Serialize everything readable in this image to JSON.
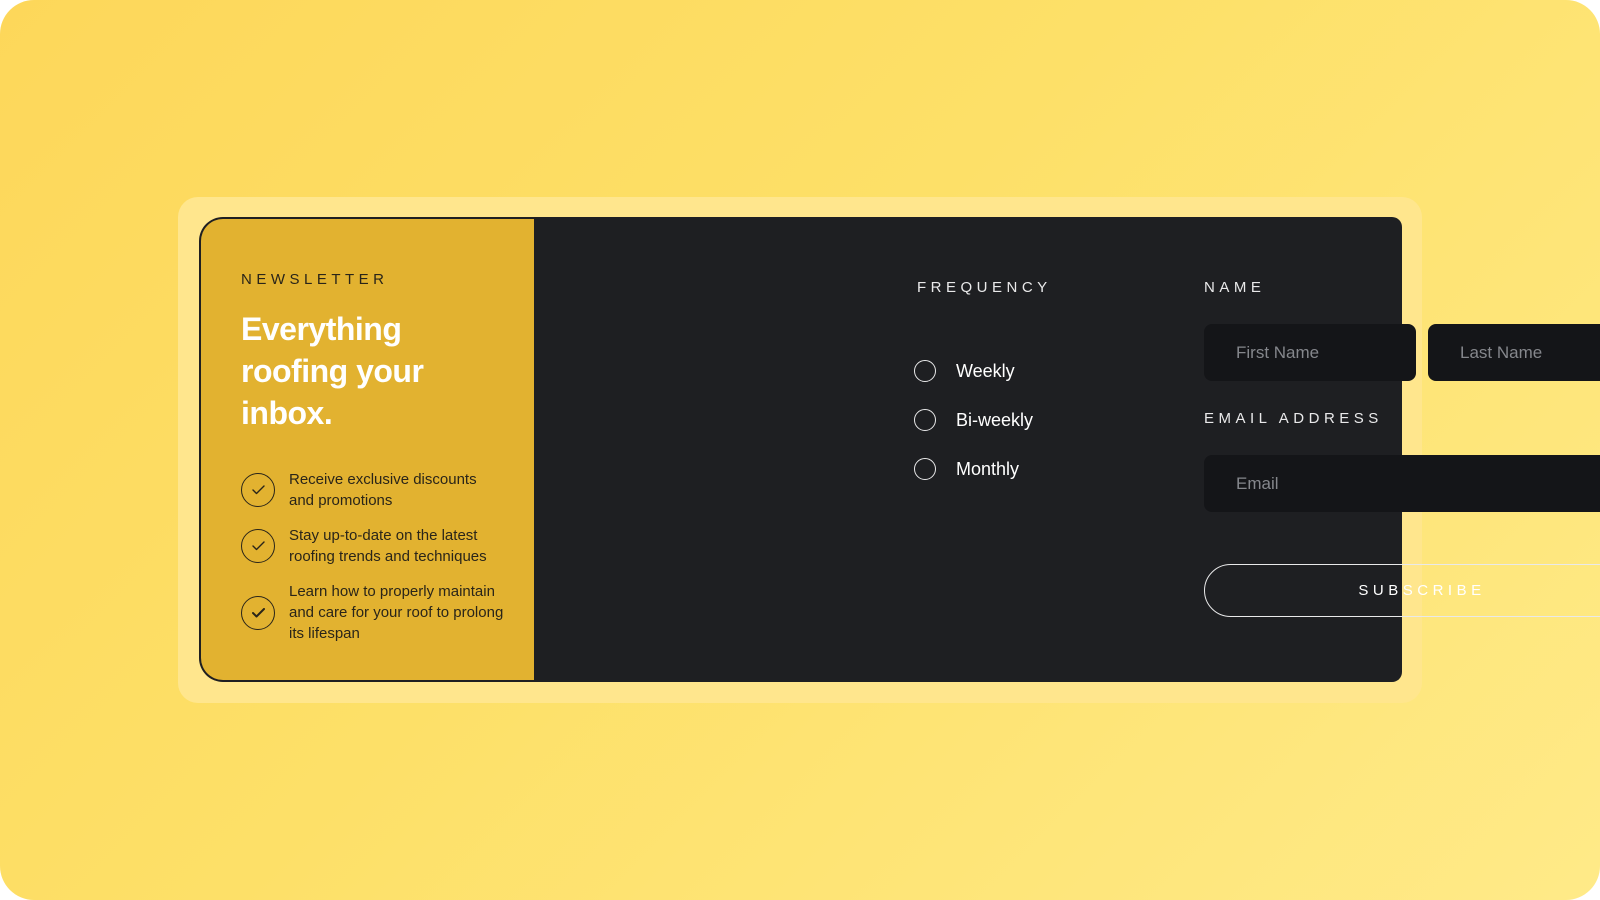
{
  "newsletter": {
    "eyebrow": "NEWSLETTER",
    "headline": "Everything roofing your inbox.",
    "benefits": [
      {
        "icon": "check-icon",
        "text": "Receive exclusive discounts and promotions"
      },
      {
        "icon": "check-icon",
        "text": "Stay up-to-date on the latest roofing trends and techniques"
      },
      {
        "icon": "check-icon",
        "text": "Learn how to properly maintain and care for your roof to prolong its lifespan"
      }
    ]
  },
  "form": {
    "frequency": {
      "label": "FREQUENCY",
      "options": [
        "Weekly",
        "Bi-weekly",
        "Monthly"
      ],
      "selected": null
    },
    "name": {
      "label": "NAME",
      "first_placeholder": "First Name",
      "last_placeholder": "Last Name",
      "first_value": "",
      "last_value": ""
    },
    "email": {
      "label": "EMAIL ADDRESS",
      "placeholder": "Email",
      "value": ""
    },
    "subscribe_label": "SUBSCRIBE"
  },
  "colors": {
    "background": "#fdd75a",
    "accent_panel": "#e2b230",
    "dark_panel": "#1e1f22",
    "input_bg": "#141518",
    "text_light": "#ffffff"
  }
}
